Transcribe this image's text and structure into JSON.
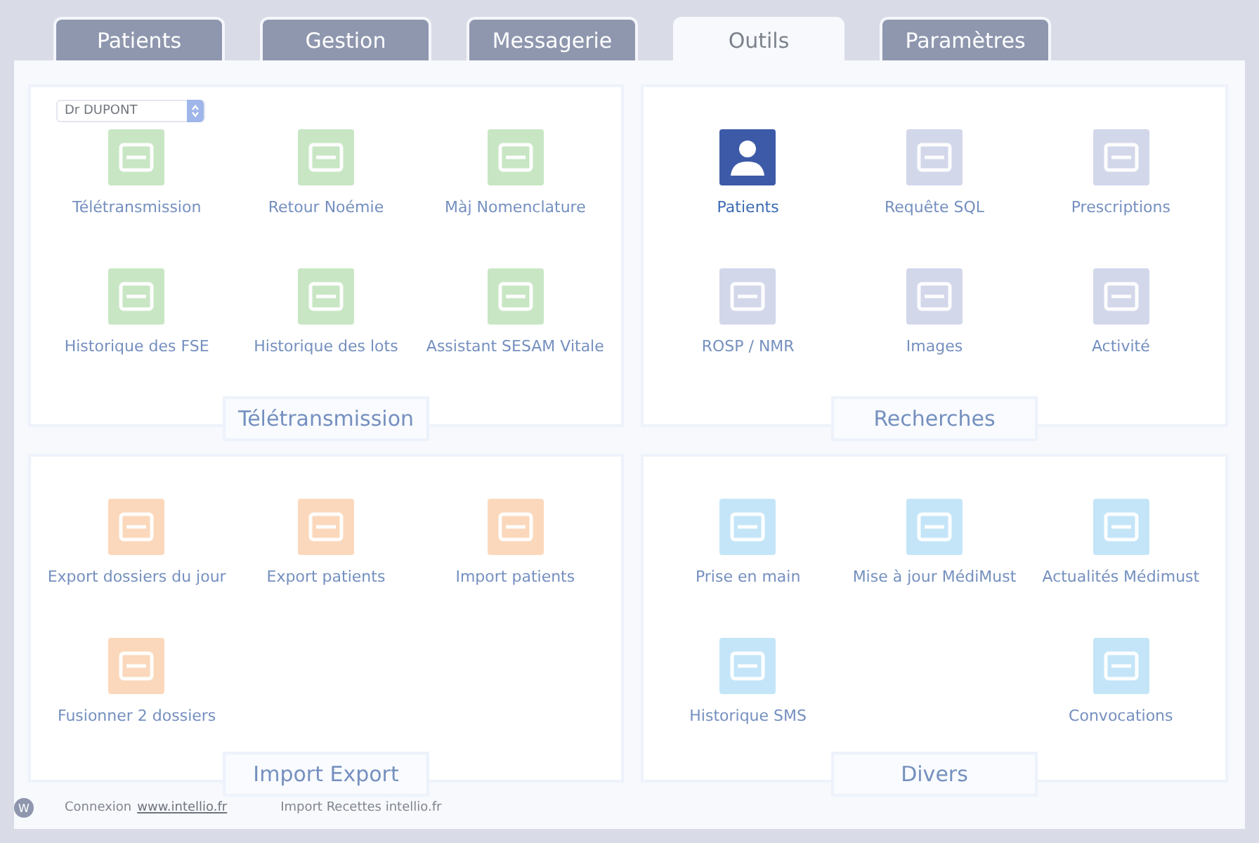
{
  "tabs": [
    {
      "label": "Patients",
      "selected": false
    },
    {
      "label": "Gestion",
      "selected": false
    },
    {
      "label": "Messagerie",
      "selected": false
    },
    {
      "label": "Outils",
      "selected": true
    },
    {
      "label": "Paramètres",
      "selected": false
    }
  ],
  "sections": [
    {
      "title": "Télétransmission",
      "color": "#c8e6c4",
      "select": {
        "value": "Dr DUPONT"
      },
      "rows": [
        [
          {
            "label": "Télétransmission",
            "selected": false
          },
          {
            "label": "Retour Noémie",
            "selected": false
          },
          {
            "label": "Màj Nomenclature",
            "selected": false
          }
        ],
        [
          {
            "label": "Historique des FSE",
            "selected": false
          },
          {
            "label": "Historique des lots",
            "selected": false
          },
          {
            "label": "Assistant SESAM Vitale",
            "selected": false
          }
        ]
      ]
    },
    {
      "title": "Recherches",
      "color": "#d2d7ea",
      "rows": [
        [
          {
            "label": "Patients",
            "selected": true
          },
          {
            "label": "Requête SQL",
            "selected": false
          },
          {
            "label": "Prescriptions",
            "selected": false
          }
        ],
        [
          {
            "label": "ROSP / NMR",
            "selected": false
          },
          {
            "label": "Images",
            "selected": false
          },
          {
            "label": "Activité",
            "selected": false
          }
        ]
      ]
    },
    {
      "title": "Import Export",
      "color": "#fbd8bb",
      "rows": [
        [
          {
            "label": "Export dossiers du jour",
            "selected": false
          },
          {
            "label": "Export patients",
            "selected": false
          },
          {
            "label": "Import patients",
            "selected": false
          }
        ],
        [
          {
            "label": "Fusionner 2 dossiers",
            "selected": false
          },
          null,
          null
        ]
      ]
    },
    {
      "title": "Divers",
      "color": "#c4e5f8",
      "rows": [
        [
          {
            "label": "Prise en main",
            "selected": false
          },
          {
            "label": "Mise à jour MédiMust",
            "selected": false
          },
          {
            "label": "Actualités Médimust",
            "selected": false
          }
        ],
        [
          {
            "label": "Historique SMS",
            "selected": false
          },
          null,
          {
            "label": "Convocations",
            "selected": false
          }
        ]
      ]
    }
  ],
  "footer": {
    "logo": "W",
    "connexion": "Connexion",
    "link": "www.intellio.fr",
    "import": "Import Recettes intellio.fr"
  }
}
